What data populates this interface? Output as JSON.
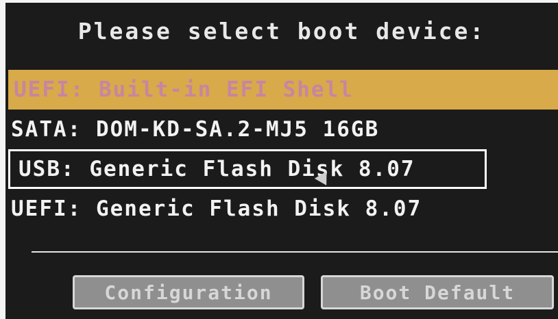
{
  "title": "Please select boot device:",
  "boot_devices": [
    {
      "label": "UEFI: Built-in EFI Shell"
    },
    {
      "label": "SATA: DOM-KD-SA.2-MJ5 16GB"
    },
    {
      "label": "USB: Generic Flash Disk 8.07"
    },
    {
      "label": "UEFI: Generic Flash Disk 8.07"
    }
  ],
  "buttons": {
    "configuration": "Configuration",
    "boot_default": "Boot Default"
  },
  "colors": {
    "background": "#1b1b1b",
    "highlight": "#d8aa4a",
    "highlight_text": "#c985a0",
    "text": "#f2f2f2"
  }
}
